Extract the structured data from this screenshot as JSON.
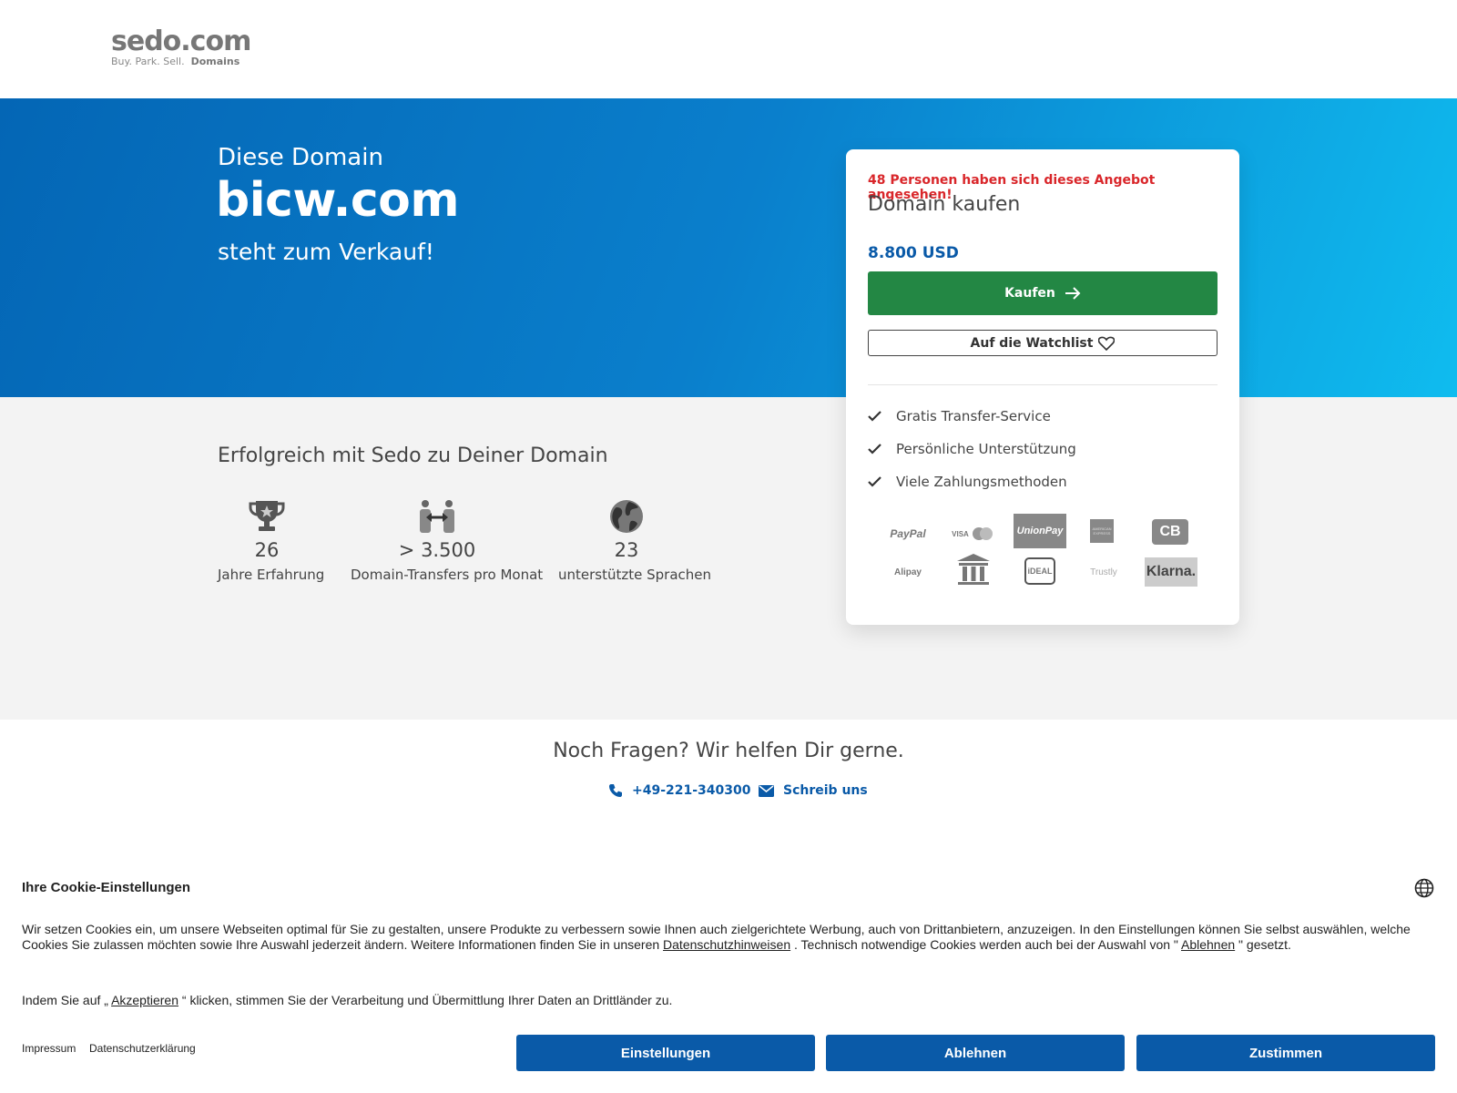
{
  "header": {
    "logo_main": "sedo.com",
    "logo_tag": "Buy.  Park.  Sell.",
    "logo_tag_bold": "Domains"
  },
  "hero": {
    "pre": "Diese Domain",
    "domain": "bicw.com",
    "post": "steht zum Verkauf!"
  },
  "stats": {
    "title": "Erfolgreich mit Sedo zu Deiner Domain",
    "items": [
      {
        "icon": "trophy-icon",
        "value": "26",
        "label": "Jahre Erfahrung"
      },
      {
        "icon": "transfer-icon",
        "value": "> 3.500",
        "label": "Domain-Transfers pro Monat"
      },
      {
        "icon": "globe-icon",
        "value": "23",
        "label": "unterstützte Sprachen"
      }
    ]
  },
  "card": {
    "alert": "48 Personen haben sich dieses Angebot angesehen!",
    "title": "Domain kaufen",
    "price": "8.800 USD",
    "buy_label": "Kaufen",
    "watch_label": "Auf die Watchlist",
    "features": [
      "Gratis Transfer-Service",
      "Persönliche Unterstützung",
      "Viele Zahlungsmethoden"
    ],
    "payments": [
      "PayPal",
      "VISA",
      "UnionPay",
      "AMERICAN EXPRESS",
      "CB",
      "Alipay",
      "Bank",
      "iDEAL",
      "Trustly",
      "Klarna."
    ]
  },
  "help": {
    "title": "Noch Fragen? Wir helfen Dir gerne.",
    "phone": "+49-221-340300",
    "mail": "Schreib uns"
  },
  "cookie": {
    "title": "Ihre Cookie-Einstellungen",
    "text_a": "Wir setzen Cookies ein, um unsere Webseiten optimal für Sie zu gestalten, unsere Produkte zu verbessern sowie Ihnen auch zielgerichtete Werbung, auch von Drittanbietern, anzuzeigen. In den Einstellungen können Sie selbst auswählen, welche Cookies Sie zulassen möchten sowie Ihre Auswahl jederzeit ändern. Weitere Informationen finden Sie in unseren ",
    "link_privacy": "Datenschutzhinweisen",
    "text_b": " . Technisch notwendige Cookies werden auch bei der Auswahl von \" ",
    "link_decline": "Ablehnen",
    "text_c": " \" gesetzt.",
    "text2_a": "Indem Sie auf „ ",
    "link_accept": "Akzeptieren",
    "text2_b": " “ klicken, stimmen Sie der Verarbeitung und Übermittlung Ihrer Daten an Drittländer zu.",
    "impressum": "Impressum",
    "datenschutz": "Datenschutzerklärung",
    "btn_settings": "Einstellungen",
    "btn_decline": "Ablehnen",
    "btn_accept": "Zustimmen"
  }
}
